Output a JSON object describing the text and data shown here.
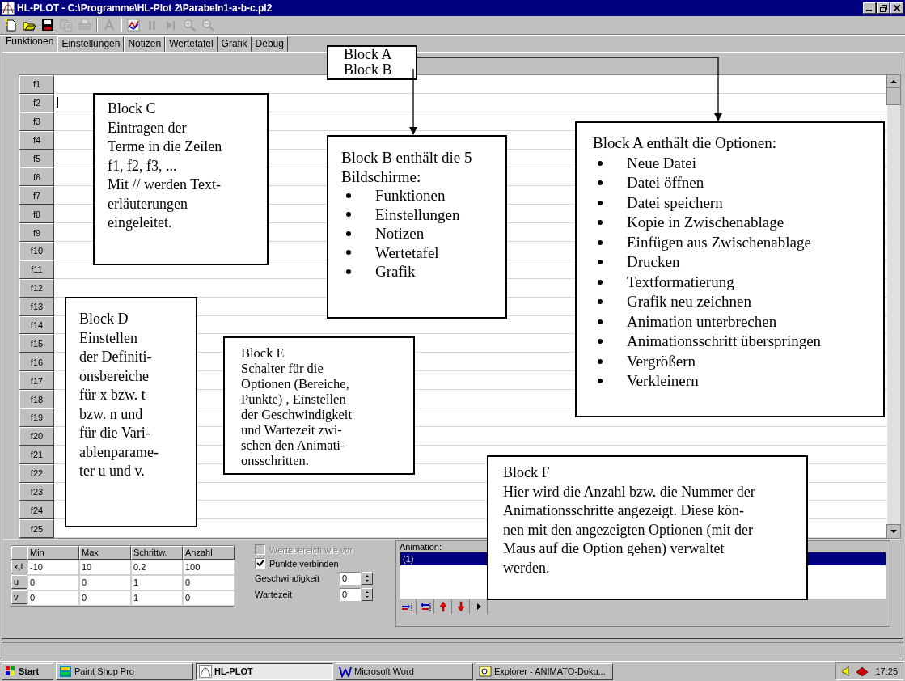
{
  "window": {
    "title": "HL-PLOT - C:\\Programme\\HL-Plot 2\\Parabeln1-a-b-c.pl2"
  },
  "toolbar": [
    {
      "kind": "new",
      "disabled": false
    },
    {
      "kind": "open",
      "disabled": false
    },
    {
      "kind": "save",
      "disabled": false
    },
    {
      "kind": "copy",
      "disabled": true
    },
    {
      "kind": "paste",
      "disabled": true
    },
    {
      "kind": "separator"
    },
    {
      "kind": "font",
      "disabled": true
    },
    {
      "kind": "separator"
    },
    {
      "kind": "graph",
      "disabled": false
    },
    {
      "kind": "pause",
      "disabled": true
    },
    {
      "kind": "step",
      "disabled": true
    },
    {
      "kind": "zoom-in",
      "disabled": true
    },
    {
      "kind": "zoom-out",
      "disabled": true
    }
  ],
  "tabs": [
    {
      "label": "Funktionen",
      "selected": true
    },
    {
      "label": "Einstellungen",
      "selected": false
    },
    {
      "label": "Notizen",
      "selected": false
    },
    {
      "label": "Wertetafel",
      "selected": false
    },
    {
      "label": "Grafik",
      "selected": false
    },
    {
      "label": "Debug",
      "selected": false
    }
  ],
  "function_rows": [
    {
      "label": "f1",
      "focused": false
    },
    {
      "label": "f2",
      "focused": true
    },
    {
      "label": "f3",
      "focused": false
    },
    {
      "label": "f4",
      "focused": false
    },
    {
      "label": "f5",
      "focused": false
    },
    {
      "label": "f6",
      "focused": false
    },
    {
      "label": "f7",
      "focused": false
    },
    {
      "label": "f8",
      "focused": false
    },
    {
      "label": "f9",
      "focused": false
    },
    {
      "label": "f10",
      "focused": false
    },
    {
      "label": "f11",
      "focused": false
    },
    {
      "label": "f12",
      "focused": false
    },
    {
      "label": "f13",
      "focused": false
    },
    {
      "label": "f14",
      "focused": false
    },
    {
      "label": "f15",
      "focused": false
    },
    {
      "label": "f16",
      "focused": false
    },
    {
      "label": "f17",
      "focused": false
    },
    {
      "label": "f18",
      "focused": false
    },
    {
      "label": "f19",
      "focused": false
    },
    {
      "label": "f20",
      "focused": false
    },
    {
      "label": "f21",
      "focused": false
    },
    {
      "label": "f22",
      "focused": false
    },
    {
      "label": "f23",
      "focused": false
    },
    {
      "label": "f24",
      "focused": false
    },
    {
      "label": "f25",
      "focused": false
    }
  ],
  "range_table": {
    "columns": [
      "Min",
      "Max",
      "Schrittw.",
      "Anzahl"
    ],
    "rows": [
      {
        "label": "x,t",
        "cells": [
          "-10",
          "10",
          "0.2",
          "100"
        ]
      },
      {
        "label": "u",
        "cells": [
          "0",
          "0",
          "1",
          "0"
        ]
      },
      {
        "label": "v",
        "cells": [
          "0",
          "0",
          "1",
          "0"
        ]
      }
    ]
  },
  "options": {
    "checkboxes": [
      {
        "label": "Wertebereich wie vor",
        "checked": false,
        "disabled": true
      },
      {
        "label": "Punkte verbinden",
        "checked": true,
        "disabled": false
      }
    ],
    "spinners": [
      {
        "label": "Geschwindigkeit",
        "value": "0"
      },
      {
        "label": "Wartezeit",
        "value": "0"
      }
    ]
  },
  "animation": {
    "label": "Animation:",
    "items": [
      {
        "text": "(1)",
        "selected": true
      }
    ],
    "buttons": [
      {
        "kind": "append"
      },
      {
        "kind": "insert"
      },
      {
        "kind": "up"
      },
      {
        "kind": "down"
      },
      {
        "kind": "play"
      }
    ]
  },
  "callouts": [
    {
      "lines": [
        "Block A",
        "Block B"
      ]
    },
    {
      "lines": [
        "Block C",
        "Eintragen der",
        "Terme in die Zeilen",
        "f1, f2, f3, ...",
        "Mit // werden Text-",
        "erläuterungen",
        "eingeleitet."
      ]
    },
    {
      "lines": [
        "Block B enthält die 5",
        "Bildschirme:"
      ],
      "bullets": [
        "Funktionen",
        "Einstellungen",
        "Notizen",
        "Wertetafel",
        "Grafik"
      ]
    },
    {
      "lines": [
        "Block A enthält die Optionen:"
      ],
      "bullets": [
        "Neue Datei",
        "Datei öffnen",
        "Datei speichern",
        "Kopie in Zwischenablage",
        "Einfügen aus Zwischenablage",
        "Drucken",
        "Textformatierung",
        "Grafik neu zeichnen",
        "Animation unterbrechen",
        "Animationsschritt überspringen",
        "Vergrößern",
        "Verkleinern"
      ]
    },
    {
      "lines": [
        "Block D",
        "Einstellen",
        "der Definiti-",
        "onsbereiche",
        "für x bzw. t",
        "bzw. n und",
        "für die Vari-",
        "ablenparame-",
        "ter u und v."
      ]
    },
    {
      "lines": [
        "Block E",
        "Schalter für die",
        "Optionen (Bereiche,",
        "Punkte) , Einstellen",
        "der Geschwindigkeit",
        "und Wartezeit zwi-",
        "schen den Animati-",
        "onsschritten."
      ]
    },
    {
      "lines": [
        "Block F",
        "Hier wird die Anzahl bzw. die Nummer der",
        "Animationsschritte angezeigt. Diese kön-",
        "nen mit den angezeigten Optionen (mit der",
        "Maus auf die Option gehen) verwaltet",
        "werden."
      ]
    }
  ],
  "taskbar": {
    "start": "Start",
    "items": [
      {
        "label": "Paint Shop Pro",
        "selected": false
      },
      {
        "label": "HL-PLOT",
        "selected": true
      },
      {
        "label": "Microsoft Word",
        "selected": false
      },
      {
        "label": "Explorer - ANIMATO-Doku...",
        "selected": false
      }
    ],
    "clock": "17:25"
  }
}
